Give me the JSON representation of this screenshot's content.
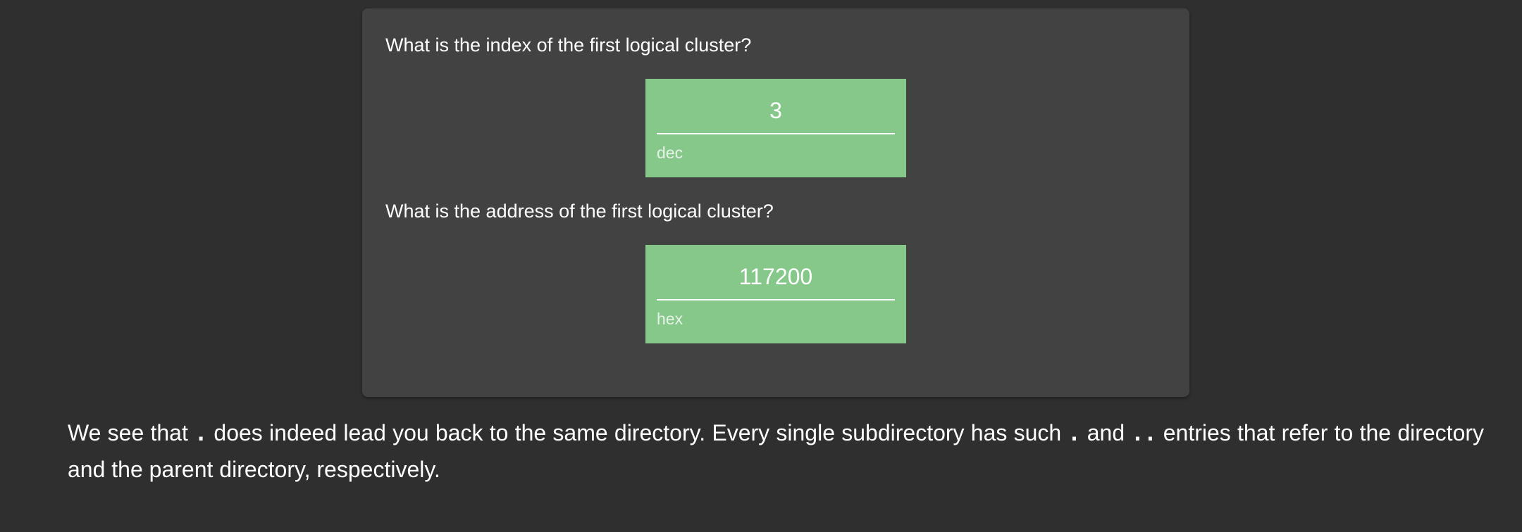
{
  "questions": [
    {
      "text": "What is the index of the first logical cluster?",
      "answer": "3",
      "unit": "dec"
    },
    {
      "text": "What is the address of the first logical cluster?",
      "answer": "117200",
      "unit": "hex"
    }
  ],
  "paragraph": {
    "part1": "We see that ",
    "code1": ".",
    "part2": " does indeed lead you back to the same directory. Every single subdirectory has such ",
    "code2": ".",
    "part3": " and ",
    "code3": "..",
    "part4": " entries that refer to the directory and the parent directory, respectively."
  },
  "colors": {
    "page_background": "#2f2f2f",
    "card_background": "#424242",
    "answer_correct": "#86c78a"
  }
}
